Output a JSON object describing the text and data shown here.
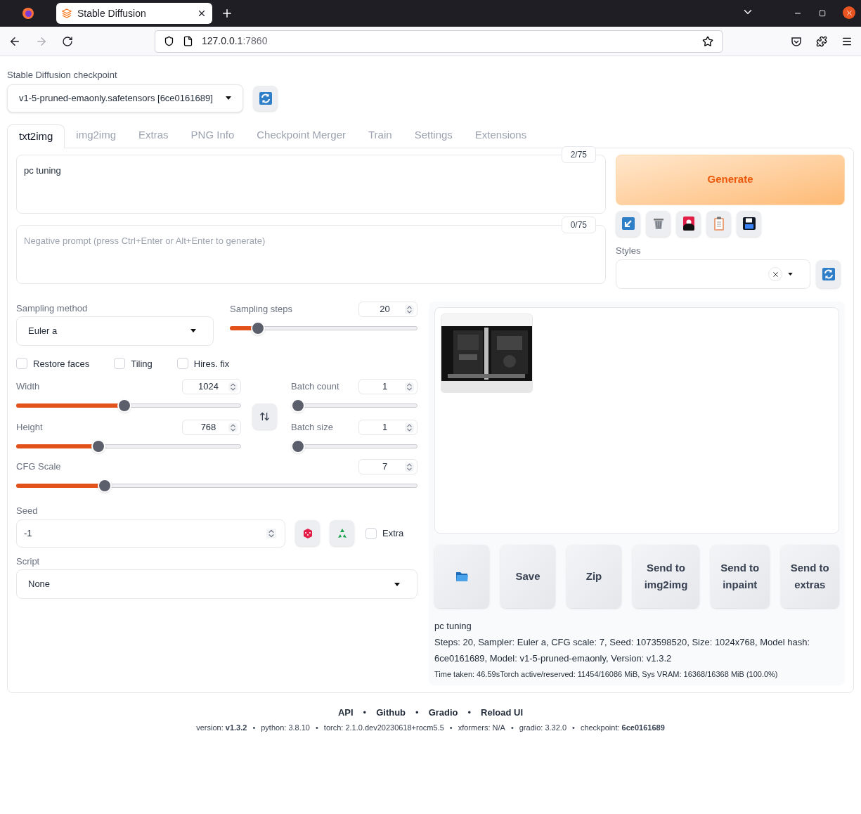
{
  "browser": {
    "tab_title": "Stable Diffusion",
    "url_host": "127.0.0.1",
    "url_port": ":7860"
  },
  "checkpoint": {
    "label": "Stable Diffusion checkpoint",
    "value": "v1-5-pruned-emaonly.safetensors [6ce0161689]"
  },
  "tabs": [
    {
      "label": "txt2img",
      "selected": true
    },
    {
      "label": "img2img",
      "selected": false
    },
    {
      "label": "Extras",
      "selected": false
    },
    {
      "label": "PNG Info",
      "selected": false
    },
    {
      "label": "Checkpoint Merger",
      "selected": false
    },
    {
      "label": "Train",
      "selected": false
    },
    {
      "label": "Settings",
      "selected": false
    },
    {
      "label": "Extensions",
      "selected": false
    }
  ],
  "prompt": {
    "value": "pc tuning",
    "token_count": "2/75"
  },
  "negative_prompt": {
    "placeholder": "Negative prompt (press Ctrl+Enter or Alt+Enter to generate)",
    "token_count": "0/75"
  },
  "generate_button": "Generate",
  "tool_buttons": [
    {
      "kind": "arrow"
    },
    {
      "kind": "trash"
    },
    {
      "kind": "card"
    },
    {
      "kind": "clipboard"
    },
    {
      "kind": "save"
    }
  ],
  "styles": {
    "label": "Styles"
  },
  "sampling_method": {
    "label": "Sampling method",
    "value": "Euler a"
  },
  "sampling_steps": {
    "label": "Sampling steps",
    "value": "20",
    "level": 0.15
  },
  "checkboxes": [
    {
      "label": "Restore faces",
      "checked": false
    },
    {
      "label": "Tiling",
      "checked": false
    },
    {
      "label": "Hires. fix",
      "checked": false
    }
  ],
  "width": {
    "label": "Width",
    "value": "1024",
    "level": 0.48
  },
  "height": {
    "label": "Height",
    "value": "768",
    "level": 0.365
  },
  "batch_count": {
    "label": "Batch count",
    "value": "1",
    "level": 0
  },
  "batch_size": {
    "label": "Batch size",
    "value": "1",
    "level": 0
  },
  "cfg_scale": {
    "label": "CFG Scale",
    "value": "7",
    "level": 0.22
  },
  "seed": {
    "label": "Seed",
    "value": "-1",
    "extra": {
      "label": "Extra",
      "checked": false
    }
  },
  "script": {
    "label": "Script",
    "value": "None"
  },
  "output_buttons": [
    {
      "kind": "folder"
    },
    {
      "kind": "text",
      "label": "Save"
    },
    {
      "kind": "text",
      "label": "Zip"
    },
    {
      "kind": "text",
      "label": "Send to img2img"
    },
    {
      "kind": "text",
      "label": "Send to inpaint"
    },
    {
      "kind": "text",
      "label": "Send to extras"
    }
  ],
  "info": {
    "prompt": "pc tuning",
    "params": "Steps: 20, Sampler: Euler a, CFG scale: 7, Seed: 1073598520, Size: 1024x768, Model hash: 6ce0161689, Model: v1-5-pruned-emaonly, Version: v1.3.2",
    "time": "Time taken: 46.59sTorch active/reserved: 11454/16086 MiB, Sys VRAM: 16368/16368 MiB (100.0%)"
  },
  "footer": {
    "links": [
      "API",
      "Github",
      "Gradio",
      "Reload UI"
    ],
    "separator": "•",
    "versions": [
      "version: **v1.3.2**",
      "python: 3.8.10",
      "torch: 2.1.0.dev20230618+rocm5.5",
      "xformers: N/A",
      "gradio: 3.32.0",
      "checkpoint: **6ce0161689**"
    ]
  }
}
